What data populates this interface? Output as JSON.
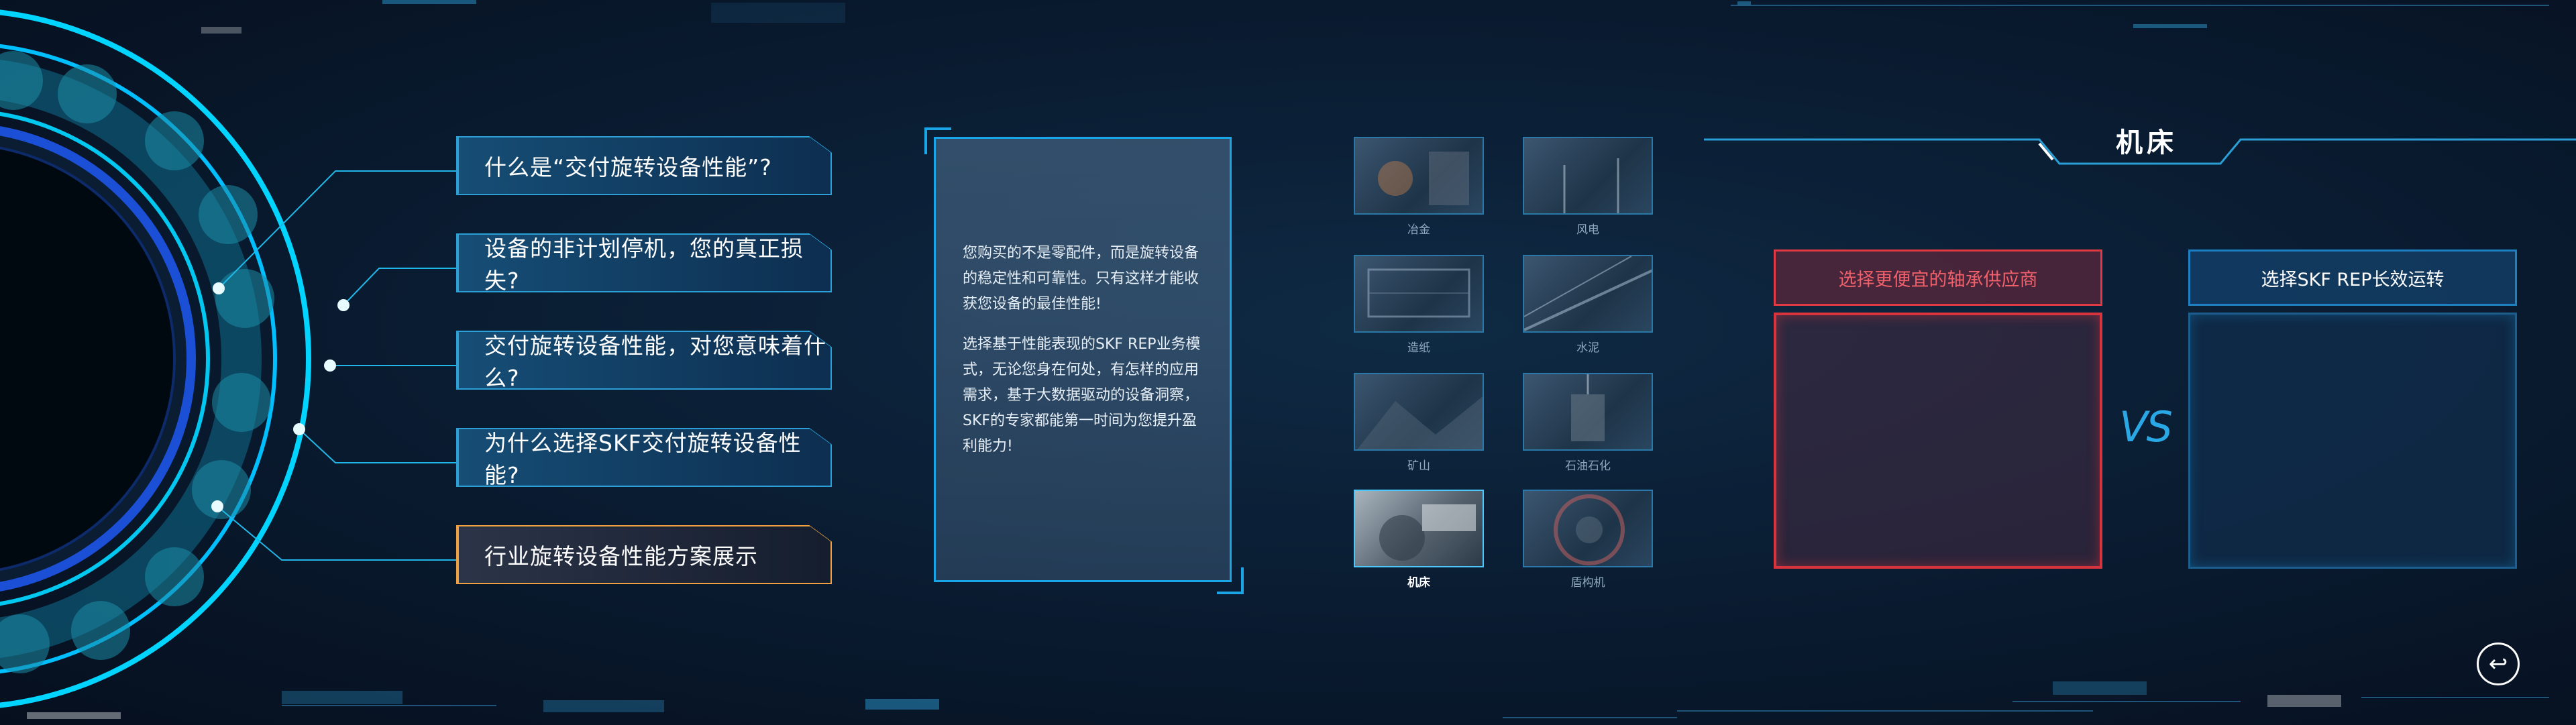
{
  "questions": [
    {
      "label": "什么是“交付旋转设备性能”?",
      "active": false
    },
    {
      "label": "设备的非计划停机，您的真正损失?",
      "active": false
    },
    {
      "label": "交付旋转设备性能，对您意味着什么?",
      "active": false
    },
    {
      "label": "为什么选择SKF交付旋转设备性能?",
      "active": false
    },
    {
      "label": "行业旋转设备性能方案展示",
      "active": true
    }
  ],
  "description": {
    "paragraph1": "您购买的不是零配件，而是旋转设备的稳定性和可靠性。只有这样才能收获您设备的最佳性能!",
    "paragraph2": "选择基于性能表现的SKF REP业务模式，无论您身在何处，有怎样的应用需求，基于大数据驱动的设备洞察，SKF的专家都能第一时间为您提升盈利能力!"
  },
  "industries": [
    {
      "label": "冶金",
      "icon": "metallurgy-image",
      "selected": false
    },
    {
      "label": "风电",
      "icon": "wind-power-image",
      "selected": false
    },
    {
      "label": "造纸",
      "icon": "papermaking-image",
      "selected": false
    },
    {
      "label": "水泥",
      "icon": "cement-image",
      "selected": false
    },
    {
      "label": "矿山",
      "icon": "mining-image",
      "selected": false
    },
    {
      "label": "石油石化",
      "icon": "petrochemical-image",
      "selected": false
    },
    {
      "label": "机床",
      "icon": "machine-tool-image",
      "selected": true
    },
    {
      "label": "盾构机",
      "icon": "tbm-image",
      "selected": false
    }
  ],
  "comparison": {
    "title": "机床",
    "left_option": "选择更便宜的轴承供应商",
    "right_option": "选择SKF REP长效运转",
    "vs": "VS"
  },
  "colors": {
    "accent": "#1aa6e6",
    "active_border": "#f0a040",
    "warning_red": "#e03a44",
    "background": "#0a1d33"
  },
  "icons": {
    "back": "back-arrow-icon"
  }
}
